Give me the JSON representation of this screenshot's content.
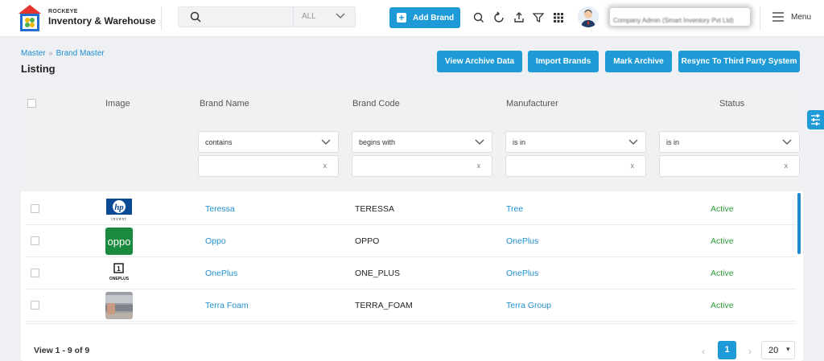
{
  "app": {
    "company_small": "ROCKEYE",
    "title": "Inventory & Warehouse"
  },
  "search": {
    "scope_value": "ALL"
  },
  "header": {
    "add_brand_label": "Add Brand",
    "user_name": "Company Admin (Smart Inventory Pvt Ltd)",
    "menu_label": "Menu"
  },
  "breadcrumb": {
    "items": [
      "Master",
      "Brand Master"
    ]
  },
  "page": {
    "title": "Listing"
  },
  "actions": {
    "view_archive": "View Archive Data",
    "import_brands": "Import Brands",
    "mark_archive": "Mark Archive",
    "resync": "Resync To Third Party System"
  },
  "table": {
    "columns": [
      "Image",
      "Brand Name",
      "Brand Code",
      "Manufacturer",
      "Status"
    ],
    "filters": {
      "brand_name_op": "contains",
      "brand_code_op": "begins with",
      "manufacturer_op": "is in",
      "status_op": "is in",
      "clear": "x"
    },
    "rows": [
      {
        "image": "hp-logo",
        "image_caption": "invent",
        "name": "Teressa",
        "code": "TERESSA",
        "manufacturer": "Tree",
        "status": "Active"
      },
      {
        "image": "oppo-logo",
        "image_text": "oppo",
        "name": "Oppo",
        "code": "OPPO",
        "manufacturer": "OnePlus",
        "status": "Active"
      },
      {
        "image": "oneplus-logo",
        "image_text": "ONEPLUS",
        "name": "OnePlus",
        "code": "ONE_PLUS",
        "manufacturer": "OnePlus",
        "status": "Active"
      },
      {
        "image": "terra-foam-photo",
        "name": "Terra Foam",
        "code": "TERRA_FOAM",
        "manufacturer": "Terra Group",
        "status": "Active"
      }
    ]
  },
  "pagination": {
    "view_text": "View 1 - 9 of 9",
    "prev": "‹",
    "current": "1",
    "next": "›",
    "page_size": "20"
  },
  "colors": {
    "primary": "#1e9ad6",
    "link": "#1e8fcf",
    "active": "#2e9e3e"
  }
}
